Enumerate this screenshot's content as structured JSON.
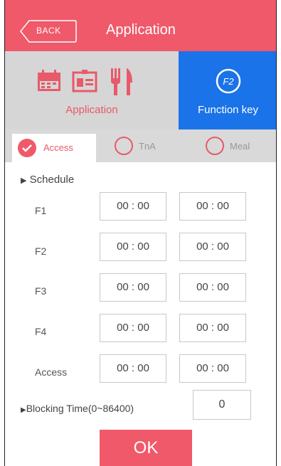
{
  "header": {
    "back_label": "BACK",
    "title": "Application"
  },
  "top_tabs": {
    "application_label": "Application",
    "function_key_label": "Function key",
    "function_key_icon_text": "F2",
    "selected": "function_key"
  },
  "sub_tabs": [
    {
      "label": "Access",
      "selected": true
    },
    {
      "label": "TnA",
      "selected": false
    },
    {
      "label": "Meal",
      "selected": false
    }
  ],
  "schedule": {
    "title": "Schedule",
    "rows": [
      {
        "label": "F1",
        "start": "00 : 00",
        "end": "00 : 00"
      },
      {
        "label": "F2",
        "start": "00 : 00",
        "end": "00 : 00"
      },
      {
        "label": "F3",
        "start": "00 : 00",
        "end": "00 : 00"
      },
      {
        "label": "F4",
        "start": "00 : 00",
        "end": "00 : 00"
      },
      {
        "label": "Access",
        "start": "00 : 00",
        "end": "00 : 00"
      }
    ]
  },
  "blocking": {
    "label": "Blocking Time(0~86400)",
    "value": "0"
  },
  "ok_label": "OK",
  "colors": {
    "accent": "#f0596a",
    "selected_tab": "#1a73e8",
    "tab_bg": "#d6d6d6"
  }
}
